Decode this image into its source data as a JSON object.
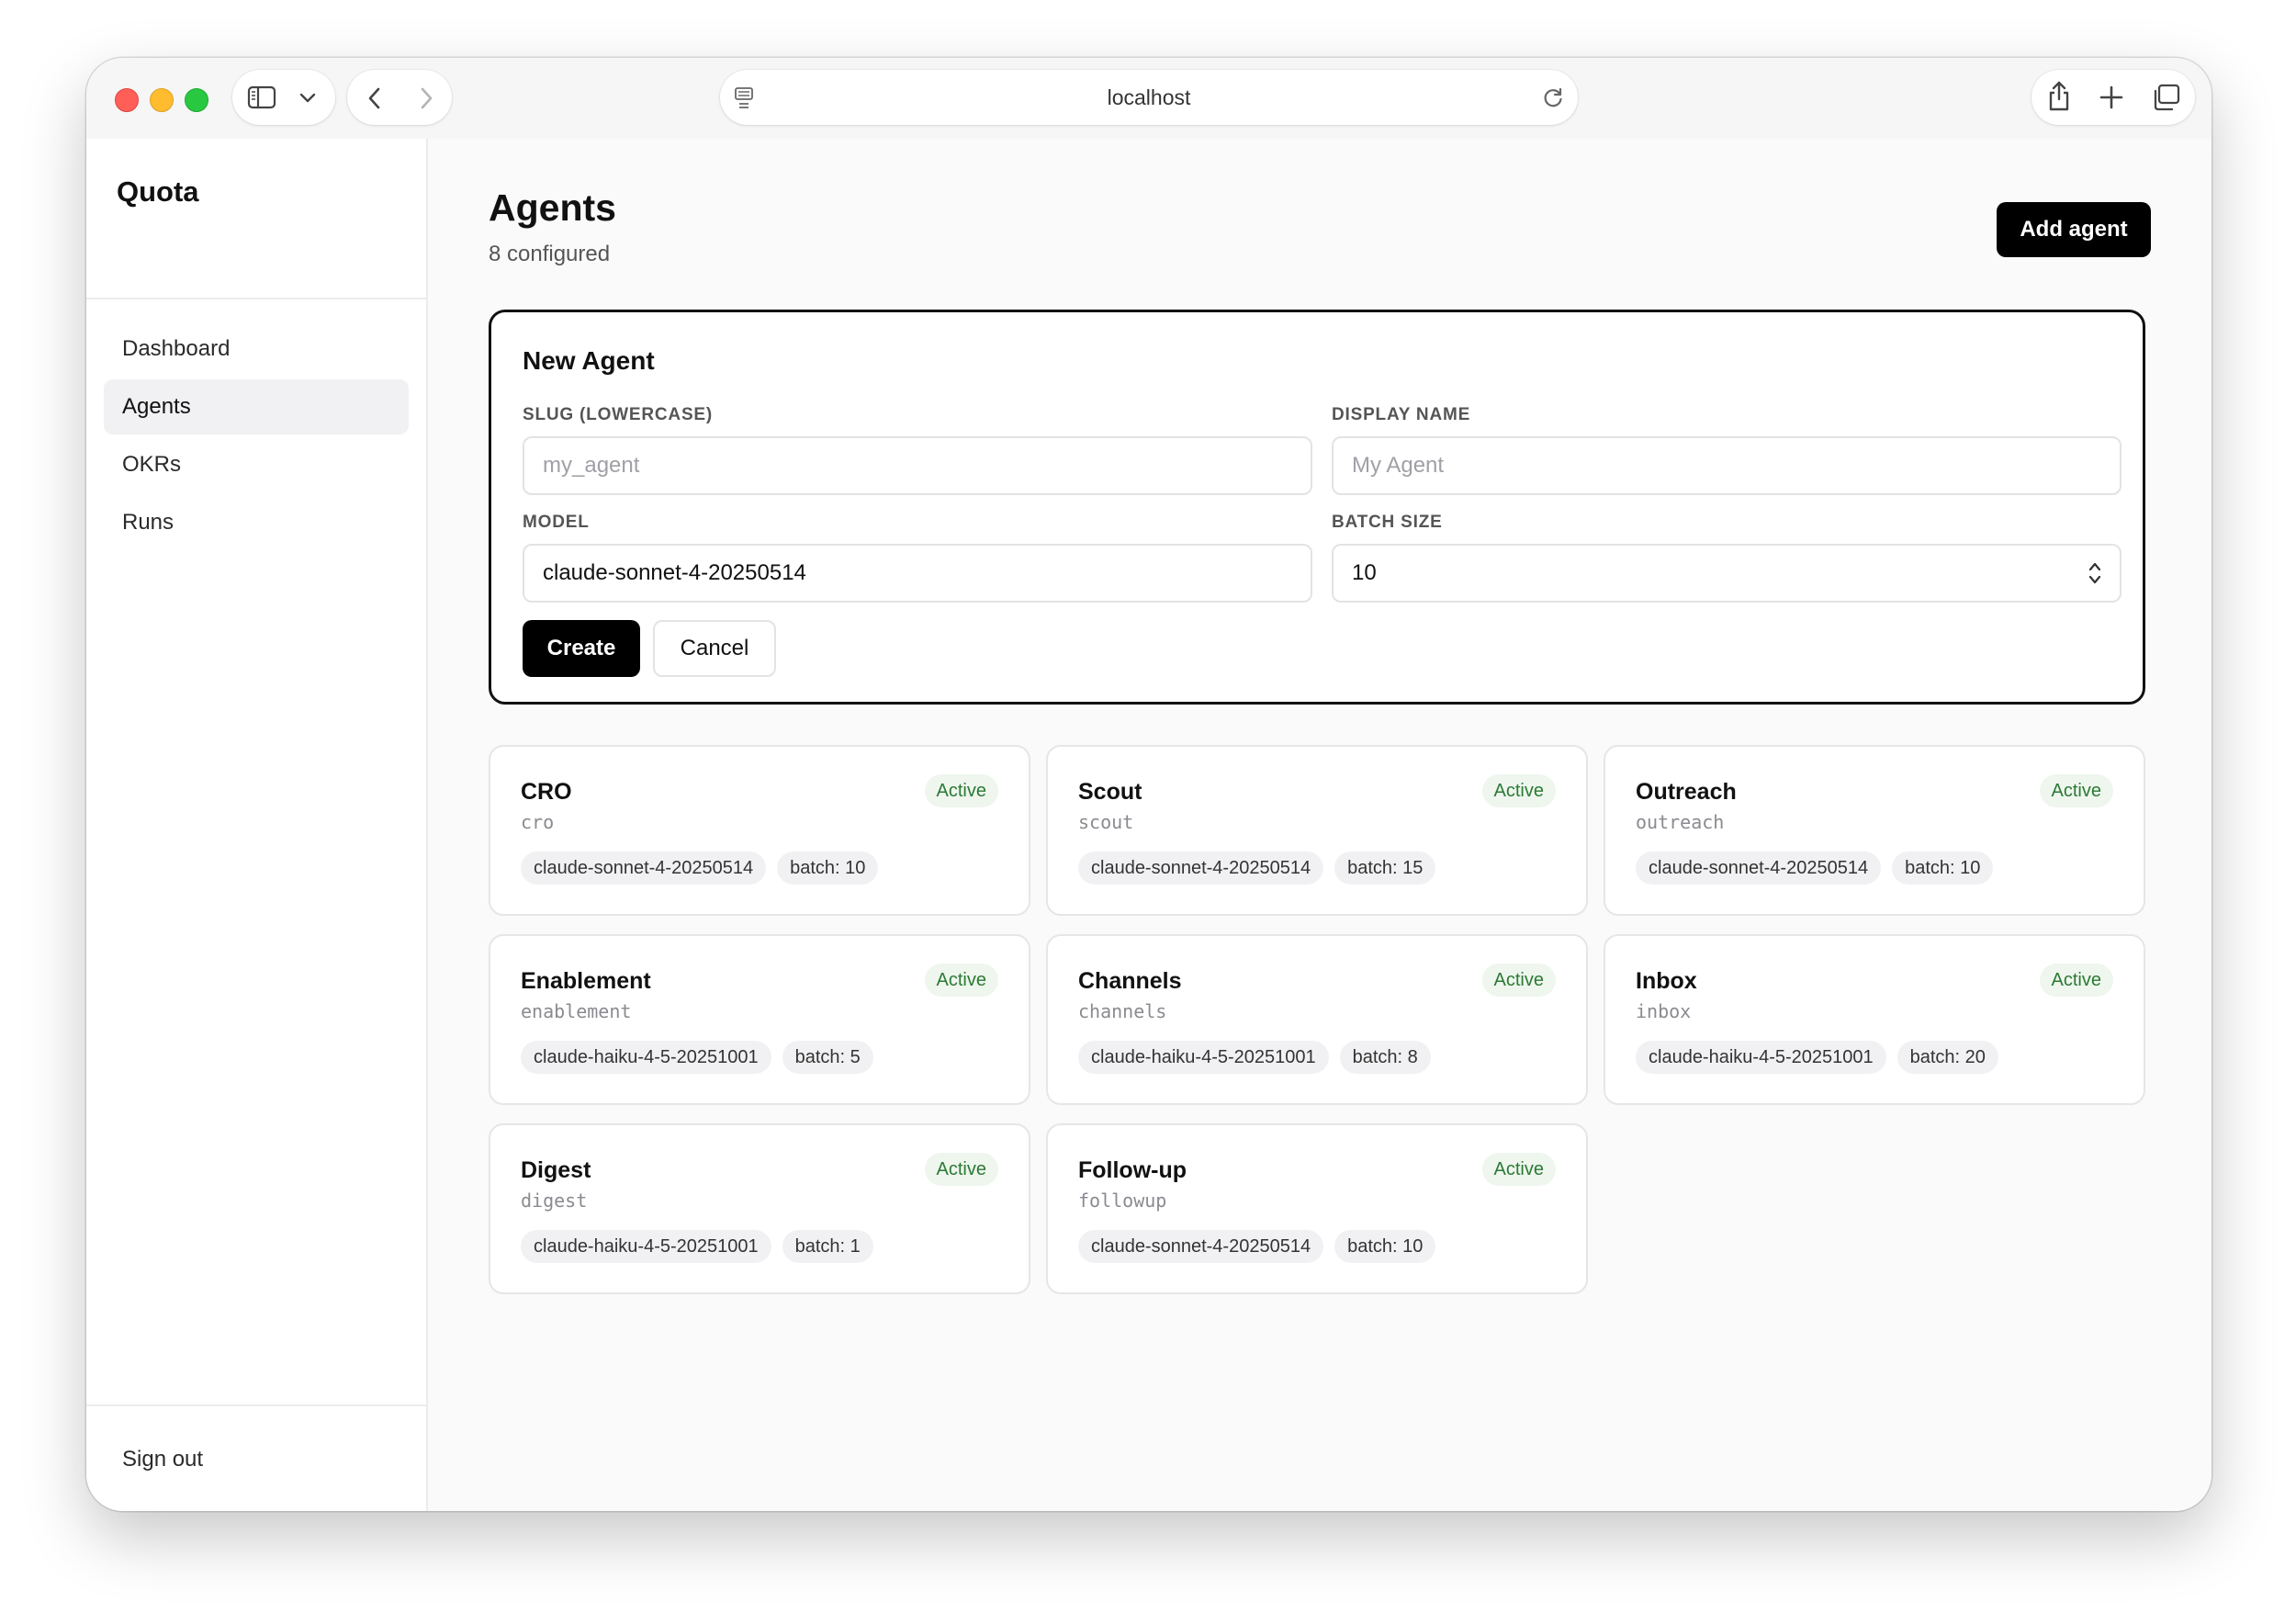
{
  "browser": {
    "url": "localhost",
    "icons": [
      "sidebar-toggle-icon",
      "chevron-down-icon",
      "back-icon",
      "forward-icon",
      "page-icon",
      "reload-icon",
      "share-icon",
      "new-tab-icon",
      "tabs-overview-icon"
    ]
  },
  "sidebar": {
    "brand": "Quota",
    "items": [
      {
        "label": "Dashboard",
        "active": false
      },
      {
        "label": "Agents",
        "active": true
      },
      {
        "label": "OKRs",
        "active": false
      },
      {
        "label": "Runs",
        "active": false
      }
    ],
    "signout": "Sign out"
  },
  "header": {
    "title": "Agents",
    "subtitle": "8 configured",
    "add_button": "Add agent"
  },
  "form": {
    "title": "New Agent",
    "slug_label": "SLUG (LOWERCASE)",
    "slug_placeholder": "my_agent",
    "display_label": "DISPLAY NAME",
    "display_placeholder": "My Agent",
    "model_label": "MODEL",
    "model_value": "claude-sonnet-4-20250514",
    "batch_label": "BATCH SIZE",
    "batch_value": "10",
    "create_button": "Create",
    "cancel_button": "Cancel"
  },
  "agents": [
    {
      "name": "CRO",
      "slug": "cro",
      "status": "Active",
      "model": "claude-sonnet-4-20250514",
      "batch": "batch: 10"
    },
    {
      "name": "Scout",
      "slug": "scout",
      "status": "Active",
      "model": "claude-sonnet-4-20250514",
      "batch": "batch: 15"
    },
    {
      "name": "Outreach",
      "slug": "outreach",
      "status": "Active",
      "model": "claude-sonnet-4-20250514",
      "batch": "batch: 10"
    },
    {
      "name": "Enablement",
      "slug": "enablement",
      "status": "Active",
      "model": "claude-haiku-4-5-20251001",
      "batch": "batch: 5"
    },
    {
      "name": "Channels",
      "slug": "channels",
      "status": "Active",
      "model": "claude-haiku-4-5-20251001",
      "batch": "batch: 8"
    },
    {
      "name": "Inbox",
      "slug": "inbox",
      "status": "Active",
      "model": "claude-haiku-4-5-20251001",
      "batch": "batch: 20"
    },
    {
      "name": "Digest",
      "slug": "digest",
      "status": "Active",
      "model": "claude-haiku-4-5-20251001",
      "batch": "batch: 1"
    },
    {
      "name": "Follow-up",
      "slug": "followup",
      "status": "Active",
      "model": "claude-sonnet-4-20250514",
      "batch": "batch: 10"
    }
  ],
  "colors": {
    "accent": "#000000",
    "status_active_text": "#2c7a34",
    "status_active_bg": "#eef6ee"
  }
}
